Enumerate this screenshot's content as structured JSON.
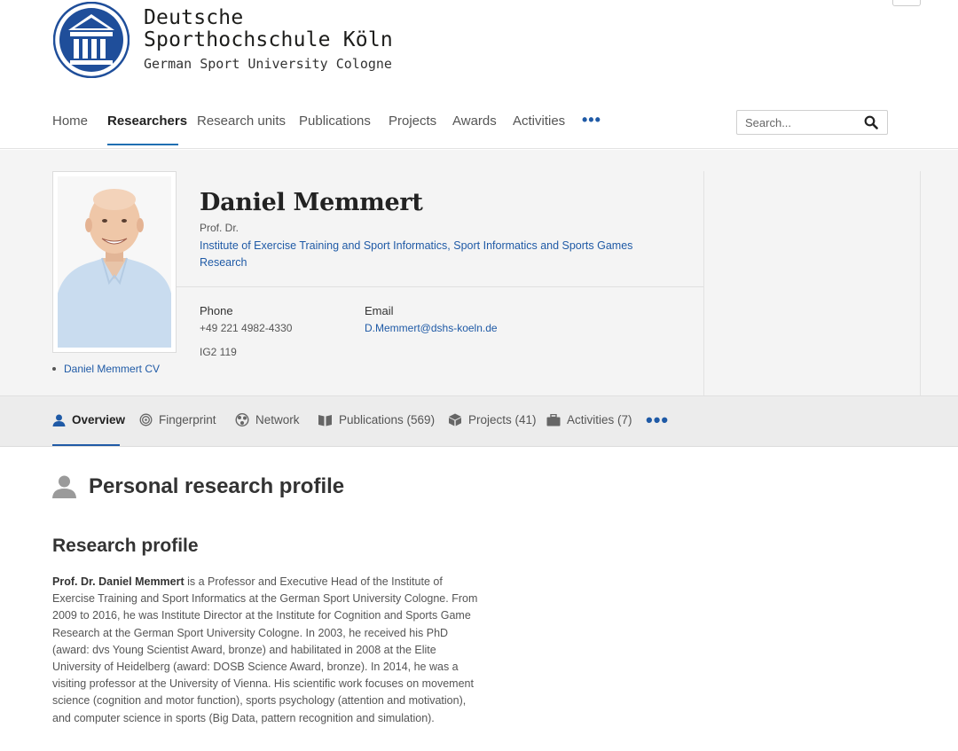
{
  "header": {
    "logo_line1": "Deutsche",
    "logo_line2": "Sporthochschule Köln",
    "logo_line3": "German Sport University Cologne"
  },
  "nav": {
    "items": [
      "Home",
      "Researchers",
      "Research units",
      "Publications",
      "Projects",
      "Awards",
      "Activities"
    ],
    "active": "Researchers",
    "more": "•••"
  },
  "search": {
    "placeholder": "Search...",
    "icon": "search-icon"
  },
  "profile": {
    "name": "Daniel Memmert",
    "title": "Prof. Dr.",
    "unit": "Institute of Exercise Training and Sport Informatics, Sport Informatics and Sports Games Research",
    "phone_label": "Phone",
    "phone": "+49 221 4982-4330",
    "room": "IG2 119",
    "email_label": "Email",
    "email": "D.Memmert@dshs-koeln.de",
    "cv_link": "Daniel Memmert CV"
  },
  "tabs": {
    "overview": "Overview",
    "fingerprint": "Fingerprint",
    "network": "Network",
    "publications": "Publications (569)",
    "projects": "Projects (41)",
    "activities": "Activities (7)",
    "more": "•••"
  },
  "content": {
    "section_title": "Personal research profile",
    "subheading": "Research profile",
    "bio_name": "Prof. Dr. Daniel Memmert",
    "bio_text": " is a Professor and Executive Head of the Institute of Exercise Training and Sport Informatics at the German Sport University Cologne. From 2009 to 2016, he was Institute Director at the Institute for Cognition and Sports Game Research at the German Sport University Cologne. In 2003, he received his PhD (award: dvs Young Scientist Award, bronze) and habilitated in 2008 at the Elite University of Heidelberg (award: DOSB Science Award, bronze). In 2014, he was a visiting professor at the University of Vienna. His scientific work focuses on movement science (cognition and motor function), sports psychology (attention and motivation), and computer science in sports (Big Data, pattern recognition and simulation)."
  },
  "colors": {
    "link": "#1f5aa6",
    "accent": "#1f6fb2",
    "logo_blue": "#1f4e9a"
  }
}
